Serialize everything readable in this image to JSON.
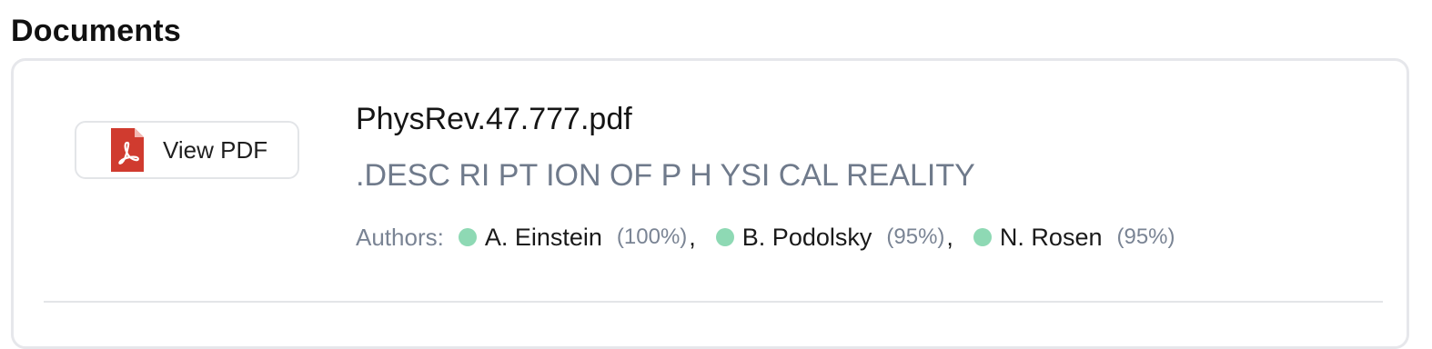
{
  "section": {
    "title": "Documents"
  },
  "document": {
    "pdf_button_label": "View PDF",
    "pdf_icon": "pdf-icon",
    "filename": "PhysRev.47.777.pdf",
    "title": ".DESC RI PT ION OF P H YSI CAL REALITY",
    "authors_label": "Authors:",
    "authors": [
      {
        "name": "A. Einstein",
        "confidence": "(100%)",
        "separator": ","
      },
      {
        "name": "B. Podolsky",
        "confidence": "(95%)",
        "separator": ","
      },
      {
        "name": "N. Rosen",
        "confidence": "(95%)",
        "separator": ""
      }
    ]
  },
  "colors": {
    "pdf_red": "#d03b2f",
    "author_dot": "#8ed9b4",
    "muted_text": "#6f7a8b"
  }
}
